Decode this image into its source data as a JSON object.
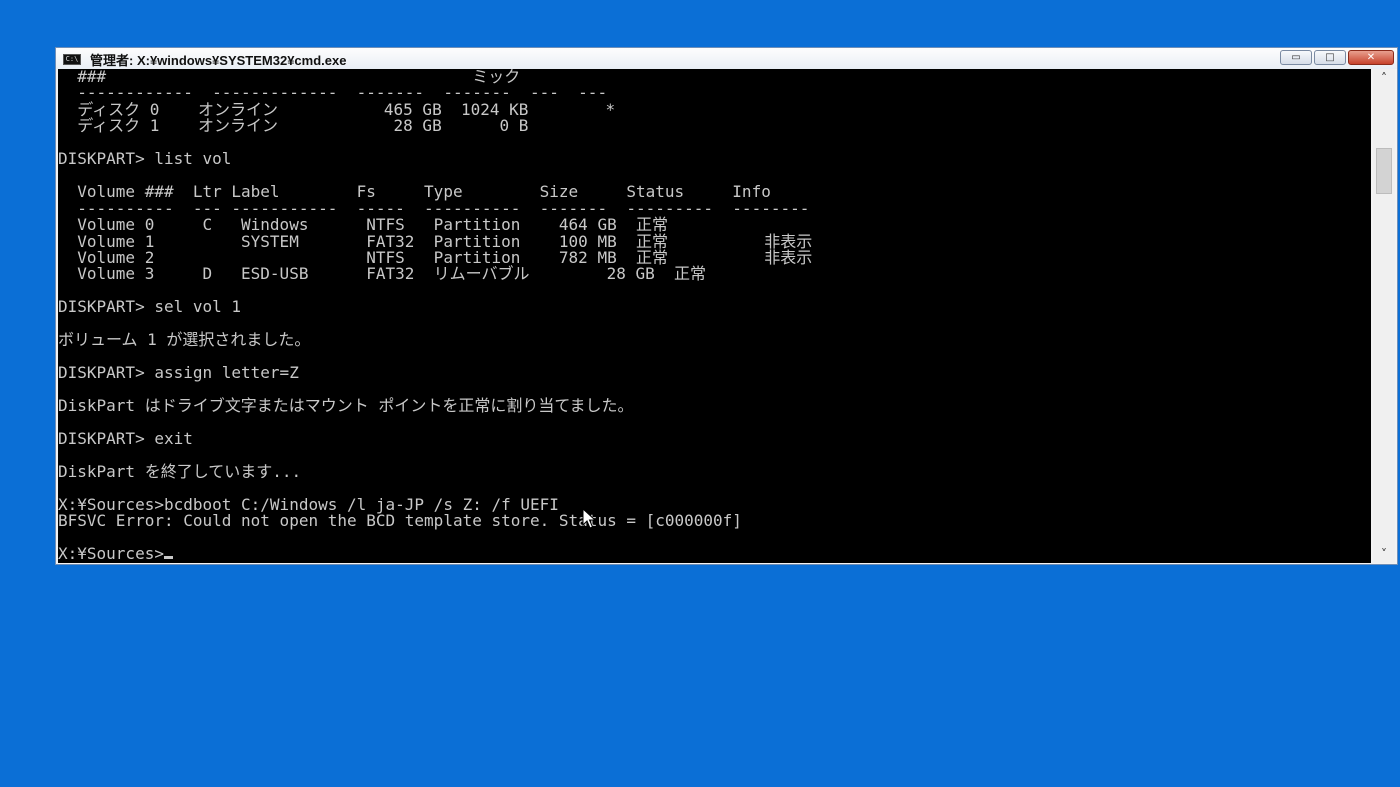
{
  "window": {
    "title": "管理者: X:¥windows¥SYSTEM32¥cmd.exe",
    "app_icon_label": "C:\\",
    "minimize_label": "▭",
    "maximize_label": "□",
    "close_label": "✕"
  },
  "console": {
    "lines": [
      "  ###                                      ミック",
      "  ------------  -------------  -------  -------  ---  ---",
      "  ディスク 0    オンライン           465 GB  1024 KB        *",
      "  ディスク 1    オンライン            28 GB      0 B",
      "",
      "DISKPART> list vol",
      "",
      "  Volume ###  Ltr Label        Fs     Type        Size     Status     Info",
      "  ----------  --- -----------  -----  ----------  -------  ---------  --------",
      "  Volume 0     C   Windows      NTFS   Partition    464 GB  正常",
      "  Volume 1         SYSTEM       FAT32  Partition    100 MB  正常          非表示",
      "  Volume 2                      NTFS   Partition    782 MB  正常          非表示",
      "  Volume 3     D   ESD-USB      FAT32  リムーバブル        28 GB  正常",
      "",
      "DISKPART> sel vol 1",
      "",
      "ボリューム 1 が選択されました。",
      "",
      "DISKPART> assign letter=Z",
      "",
      "DiskPart はドライブ文字またはマウント ポイントを正常に割り当てました。",
      "",
      "DISKPART> exit",
      "",
      "DiskPart を終了しています...",
      "",
      "X:¥Sources>bcdboot C:/Windows /l ja-JP /s Z: /f UEFI",
      "BFSVC Error: Could not open the BCD template store. Status = [c000000f]",
      ""
    ],
    "prompt": "X:¥Sources>"
  },
  "scrollbar": {
    "up_arrow": "˄",
    "down_arrow": "˅"
  }
}
